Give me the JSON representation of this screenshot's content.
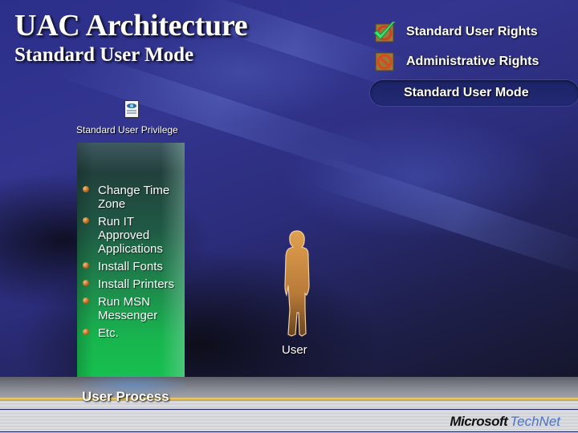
{
  "slide": {
    "title": "UAC Architecture",
    "subtitle": "Standard User Mode"
  },
  "legend": {
    "items": [
      {
        "icon": "checkmark-icon",
        "label": "Standard User Rights"
      },
      {
        "icon": "prohibited-icon",
        "label": "Administrative Rights"
      }
    ],
    "mode_label": "Standard User Mode"
  },
  "privilege": {
    "icon": "document-icon",
    "label": "Standard User Privilege",
    "items": [
      "Change Time Zone",
      "Run IT Approved Applications",
      "Install Fonts",
      "Install Printers",
      "Run MSN Messenger",
      "Etc."
    ]
  },
  "process": {
    "label": "User Process"
  },
  "user": {
    "icon": "user-silhouette-icon",
    "label": "User"
  },
  "footer": {
    "brand_microsoft": "Microsoft",
    "brand_product": "TechNet"
  },
  "colors": {
    "background": "#2c2f8a",
    "panel_green": "#16c24f",
    "accent_gold": "#f0d078",
    "brand_blue": "#4b72c8"
  }
}
